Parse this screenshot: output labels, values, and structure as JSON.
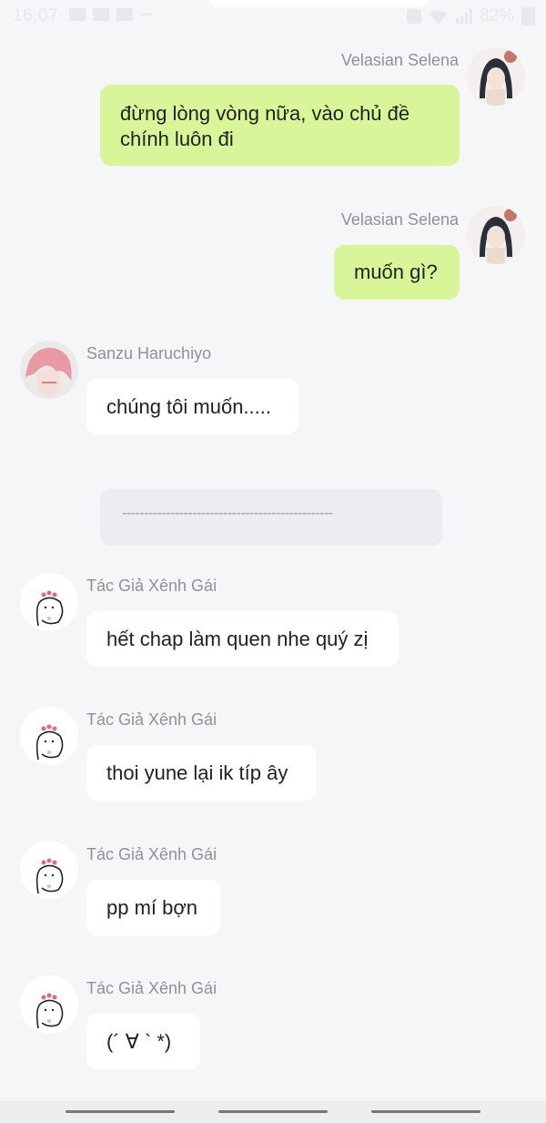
{
  "status_bar": {
    "time": "16:07",
    "battery": "82%",
    "icons": [
      "image-icon",
      "video-icon",
      "gallery-icon",
      "more-dots-icon",
      "alarm-icon",
      "wifi-icon",
      "signal-icon",
      "battery-icon"
    ]
  },
  "messages": [
    {
      "sender": "Velasian Selena",
      "text": "đừng lòng vòng nữa, vào chủ đề chính luôn đi",
      "side": "right",
      "avatar": "anime-girl-avatar"
    },
    {
      "sender": "Velasian Selena",
      "text": "muốn gì?",
      "side": "right",
      "avatar": "anime-girl-avatar"
    },
    {
      "sender": "Sanzu Haruchiyo",
      "text": "chúng tôi muốn.....",
      "side": "left",
      "avatar": "pink-hair-avatar"
    },
    {
      "divider": "------------------------------------------------"
    },
    {
      "sender": "Tác Giả Xênh Gái",
      "text": "hết chap làm quen nhe quý zị",
      "side": "left",
      "avatar": "doodle-avatar"
    },
    {
      "sender": "Tác Giả Xênh Gái",
      "text": "thoi yune lại ik típ ây",
      "side": "left",
      "avatar": "doodle-avatar"
    },
    {
      "sender": "Tác Giả Xênh Gái",
      "text": "pp mí bợn",
      "side": "left",
      "avatar": "doodle-avatar"
    },
    {
      "sender": "Tác Giả Xênh Gái",
      "text": "(´ ∀ ` *)",
      "side": "left",
      "avatar": "doodle-avatar"
    }
  ],
  "colors": {
    "background": "#f5f6f8",
    "my_bubble": "#d8f59a",
    "their_bubble": "#ffffff",
    "name_text": "#8e9196"
  }
}
